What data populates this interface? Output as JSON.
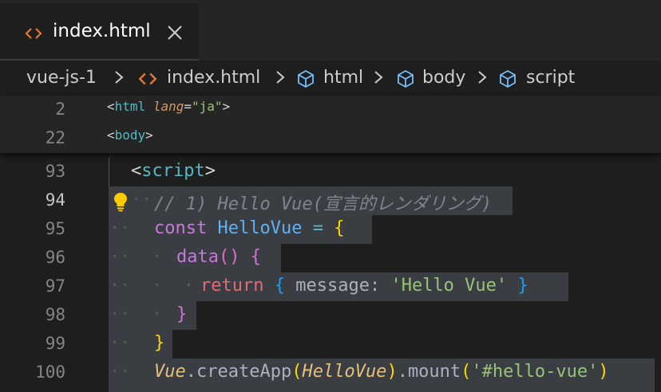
{
  "tab": {
    "label": "index.html",
    "icon": "code-file-icon",
    "close_icon": "close-icon"
  },
  "breadcrumb": {
    "items": [
      {
        "label": "vue-js-1",
        "icon": null
      },
      {
        "label": "index.html",
        "icon": "code-file-icon"
      },
      {
        "label": "html",
        "icon": "cube-icon"
      },
      {
        "label": "body",
        "icon": "cube-icon"
      },
      {
        "label": "script",
        "icon": "cube-icon"
      }
    ]
  },
  "sticky_scroll": [
    {
      "line_number": "2",
      "tokens": [
        "<",
        "html",
        " ",
        "lang",
        "=",
        "\"ja\"",
        ">"
      ]
    },
    {
      "line_number": "22",
      "tokens": [
        "<",
        "body",
        ">"
      ]
    }
  ],
  "lines": [
    {
      "line_number": "93",
      "text": "<script>"
    },
    {
      "line_number": "94",
      "text": "// 1) Hello Vue(宣言的レンダリング)"
    },
    {
      "line_number": "95",
      "text": "const HelloVue = {"
    },
    {
      "line_number": "96",
      "text": "data() {"
    },
    {
      "line_number": "97",
      "text": "return { message: 'Hello Vue' }"
    },
    {
      "line_number": "98",
      "text": "}"
    },
    {
      "line_number": "99",
      "text": "}"
    },
    {
      "line_number": "100",
      "text": "Vue.createApp(HelloVue).mount('#hello-vue')"
    }
  ],
  "tokens": {
    "l2": {
      "lt": "<",
      "tag": "html",
      "attr": "lang",
      "eq": "=",
      "val": "\"ja\"",
      "gt": ">"
    },
    "l22": {
      "lt": "<",
      "tag": "body",
      "gt": ">"
    },
    "l93": {
      "lt": "<",
      "tag": "script",
      "gt": ">"
    },
    "l94": {
      "comment": "// 1) Hello Vue(宣言的レンダリング)"
    },
    "l95": {
      "kw": "const",
      "name": "HelloVue",
      "eq": "=",
      "brace": "{"
    },
    "l96": {
      "fn": "data",
      "paren": "()",
      "brace": "{"
    },
    "l97": {
      "kw": "return",
      "ob": "{",
      "key": "message",
      "colon": ":",
      "str": "'Hello Vue'",
      "cb": "}"
    },
    "l98": {
      "brace": "}"
    },
    "l99": {
      "brace": "}"
    },
    "l100": {
      "obj": "Vue",
      "dot": ".",
      "fn": "createApp",
      "op": "(",
      "arg": "HelloVue",
      "cp": ")",
      "dot2": ".",
      "fn2": "mount",
      "op2": "(",
      "str": "'#hello-vue'",
      "cp2": ")"
    }
  },
  "active_line": "94",
  "lightbulb_icon": "lightbulb-icon"
}
